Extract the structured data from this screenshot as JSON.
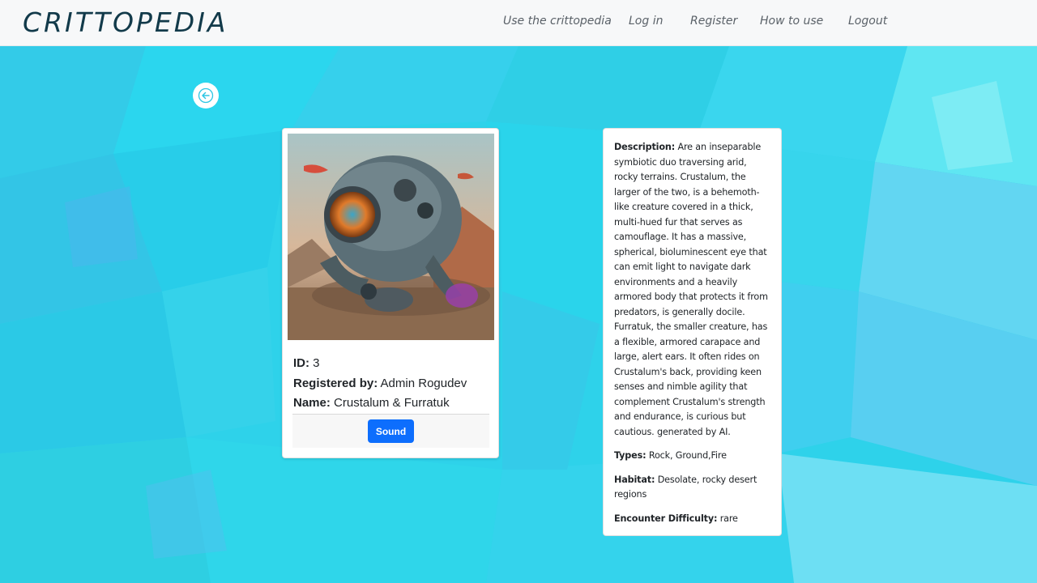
{
  "brand": "CRITTOPEDIA",
  "nav": {
    "items": [
      {
        "label": "Use the crittopedia"
      },
      {
        "label": "Log in"
      },
      {
        "label": "Register"
      },
      {
        "label": "How to use"
      },
      {
        "label": "Logout"
      }
    ]
  },
  "back_icon": "arrow-left-icon",
  "creature": {
    "image_alt": "creature-image",
    "id_label": "ID:",
    "id_value": "3",
    "registered_label": "Registered by:",
    "registered_value": "Admin Rogudev",
    "name_label": "Name:",
    "name_value": "Crustalum & Furratuk",
    "sound_button": "Sound"
  },
  "details": {
    "description_label": "Description:",
    "description_value": "Are an inseparable symbiotic duo traversing arid, rocky terrains. Crustalum, the larger of the two, is a behemoth-like creature covered in a thick, multi-hued fur that serves as camouflage. It has a massive, spherical, bioluminescent eye that can emit light to navigate dark environments and a heavily armored body that protects it from predators, is generally docile. Furratuk, the smaller creature, has a flexible, armored carapace and large, alert ears. It often rides on Crustalum's back, providing keen senses and nimble agility that complement Crustalum's strength and endurance, is curious but cautious. generated by AI.",
    "types_label": "Types:",
    "types_value": "Rock, Ground,Fire",
    "habitat_label": "Habitat:",
    "habitat_value": "Desolate, rocky desert regions",
    "difficulty_label": "Encounter Difficulty:",
    "difficulty_value": "rare"
  },
  "colors": {
    "background": "#2fd3ea",
    "navbar": "#f7f8f9",
    "brand": "#123a4a",
    "sound_button": "#0d6efd"
  }
}
